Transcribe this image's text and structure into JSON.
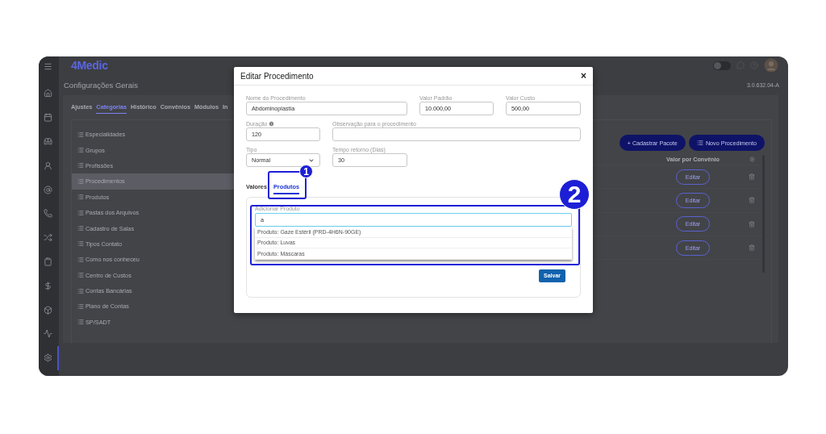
{
  "app": {
    "logo": "4Medic",
    "page_title": "Configurações Gerais",
    "version": "3.0.632.04-A",
    "theme_toggle": {
      "on": false
    }
  },
  "sidebar": {
    "items": [
      {
        "selected": false
      },
      {
        "selected": false
      },
      {
        "selected": false
      },
      {
        "selected": false
      },
      {
        "selected": false
      },
      {
        "selected": false
      },
      {
        "selected": false
      },
      {
        "selected": false
      },
      {
        "selected": false
      },
      {
        "selected": false
      },
      {
        "selected": false
      },
      {
        "selected": true
      }
    ]
  },
  "tabs": [
    {
      "label": "Ajustes",
      "selected": false
    },
    {
      "label": "Categorias",
      "selected": true
    },
    {
      "label": "Histórico",
      "selected": false
    },
    {
      "label": "Convênios",
      "selected": false
    },
    {
      "label": "Módulos",
      "selected": false
    },
    {
      "label": "In",
      "selected": false
    }
  ],
  "categories": [
    {
      "label": "Especialidades",
      "selected": false
    },
    {
      "label": "Grupos",
      "selected": false
    },
    {
      "label": "Profissões",
      "selected": false
    },
    {
      "label": "Procedimentos",
      "selected": true
    },
    {
      "label": "Produtos",
      "selected": false
    },
    {
      "label": "Pastas dos Arquivos",
      "selected": false
    },
    {
      "label": "Cadastro de Salas",
      "selected": false
    },
    {
      "label": "Tipos Contato",
      "selected": false
    },
    {
      "label": "Como nos conheceu",
      "selected": false
    },
    {
      "label": "Centro de Custos",
      "selected": false
    },
    {
      "label": "Contas Bancárias",
      "selected": false
    },
    {
      "label": "Plano de Contas",
      "selected": false
    },
    {
      "label": "SP/SADT",
      "selected": false
    }
  ],
  "actions": [
    {
      "label": "+ Cadastrar Pacote",
      "kind": "plain"
    },
    {
      "label": "Novo Procedimento",
      "kind": "list"
    }
  ],
  "table": {
    "columns": [
      "Valor por Convênio"
    ],
    "rows": [
      {
        "action": "Editar"
      },
      {
        "action": "Editar"
      },
      {
        "action": "Editar"
      },
      {
        "action": "Editar"
      }
    ]
  },
  "modal": {
    "title": "Editar Procedimento",
    "close": "×",
    "rows": [
      [
        {
          "label": "Nome do Procedimento",
          "value": "Abdominoplastia",
          "kind": "text"
        },
        {
          "label": "Valor Padrão",
          "value": "10.000,00",
          "kind": "text"
        },
        {
          "label": "Valor Custo",
          "value": "500,00",
          "kind": "text"
        }
      ],
      [
        {
          "label": "Duração",
          "value": "120",
          "kind": "text",
          "info": true
        },
        {
          "label": "Observação para o procedimento",
          "kind": "text"
        }
      ],
      [
        {
          "label": "Tipo",
          "value": "Normal",
          "kind": "select"
        },
        {
          "label": "Tempo retorno (Dias)",
          "value": "30",
          "kind": "text"
        }
      ]
    ],
    "tabs": [
      {
        "label": "Valores",
        "selected": false
      },
      {
        "label": "Produtos",
        "selected": true,
        "annotation": "1"
      }
    ],
    "add_product": {
      "label": "Adicionar Produto",
      "value": "a",
      "focused": true,
      "annotation": "2"
    },
    "options": [
      "Produto: Gaze Estéril (PRD-4H6N-90GE)",
      "Produto: Luvas",
      "Produto: Máscaras"
    ],
    "save": "Salvar"
  }
}
